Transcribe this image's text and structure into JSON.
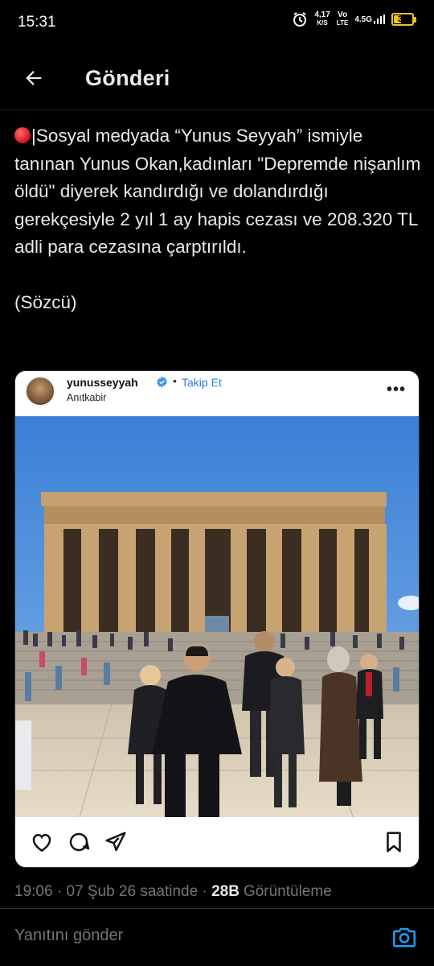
{
  "status_bar": {
    "time": "15:31",
    "speed_value": "4,17",
    "speed_unit": "K/S",
    "volte_top": "Vo",
    "volte_bottom": "LTE",
    "network": "4.5G",
    "battery": "37",
    "battery_level_percent": 37,
    "accent_color": "#e8c42a"
  },
  "header": {
    "title": "Gönderi",
    "back_icon": "arrow-left-icon"
  },
  "tweet": {
    "text": "|Sosyal medyada “Yunus Seyyah” ismiyle tanınan Yunus Okan,kadınları \"Depremde nişanlım öldü\" diyerek kandırdığı ve dolandırdığı gerekçesiyle 2 yıl 1 ay hapis cezası ve 208.320 TL adli para cezasına çarptırıldı.\n\n(Sözcü)",
    "emoji_icon": "red-circle-icon",
    "meta_time": "19:06",
    "meta_date": "07 Şub 26 saatinde",
    "meta_sep": "·",
    "views_count": "28B",
    "views_label": "Görüntüleme"
  },
  "embedded_post": {
    "username": "yunusseyyah",
    "verified_icon": "verified-badge-icon",
    "separator": "•",
    "follow_label": "Takip Et",
    "location": "Anıtkabir",
    "more_label": "•••",
    "actions": [
      "heart-icon",
      "comment-icon",
      "share-icon",
      "bookmark-icon"
    ],
    "link_color": "#2e7cd6"
  },
  "reply_bar": {
    "placeholder": "Yanıtını gönder",
    "camera_icon": "camera-icon",
    "accent_color": "#1d9bf0"
  }
}
